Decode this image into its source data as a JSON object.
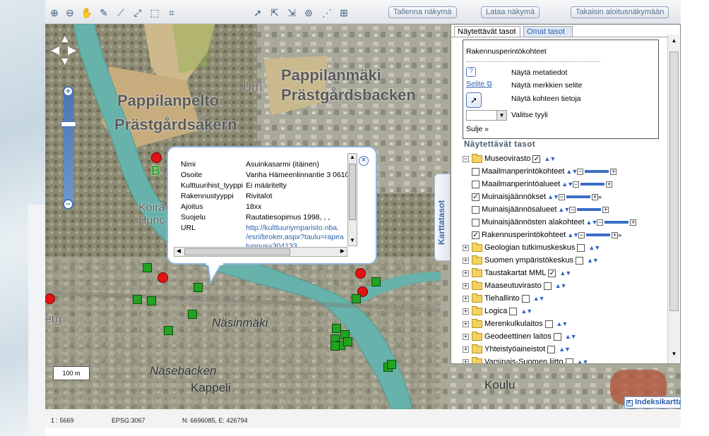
{
  "toolbar": {
    "save_view": "Tallenna näkymä",
    "load_view": "Lataa näkymä",
    "reset_view": "Takaisin aloitusnäkymään"
  },
  "map": {
    "labels": {
      "pappilanpelto": "Pappilanpelto",
      "prastgardsakern": "Prästgårdsåkern",
      "pappilanmaki": "Pappilanmäki",
      "prastgardsbacken": "Prästgårdsbacken",
      "urh": "Urh",
      "nasinmaki": "Näsinmäki",
      "nasebacken": "Näsebacken",
      "kappeli": "Kappeli",
      "koulu": "Koulu",
      "koira": "Koira",
      "hunc": "Hunc",
      "erg": "erg",
      "b": "B"
    },
    "scale_bar": "100 m",
    "index_map": "Indeksikartta",
    "map_layers_tab": "Karttatasot"
  },
  "popup": {
    "rows": [
      {
        "key": "Nimi",
        "value": "Asuinkasarmi (itäinen)"
      },
      {
        "key": "Osoite",
        "value": "Vanha Hämeenlinnantie 3 0610"
      },
      {
        "key": "Kulttuurihist_tyyppi",
        "value": "Ei määritelty"
      },
      {
        "key": "Rakennustyyppi",
        "value": "Rivitalot"
      },
      {
        "key": "Ajoitus",
        "value": "18xx"
      },
      {
        "key": "Suojelu",
        "value": "Rautatiesopimus 1998, , ,"
      },
      {
        "key": "URL",
        "value": "http://kulttuuriymparisto.nba."
      }
    ],
    "url_line2": "/esri/broker.aspx?taulu=rapea",
    "url_line3": "tunnus=304133"
  },
  "panel": {
    "tabs": [
      "Näytettävät tasot",
      "Omat tasot"
    ],
    "info": {
      "title": "Rakennusperintökohteet",
      "metadata": "Näytä metatiedot",
      "legend_link": "Selite",
      "legend": "Näytä merkkien selite",
      "show_info": "Näytä kohteen tietoja",
      "style": "Valitse tyyli",
      "close": "Sulje »"
    },
    "tree_title": "Näytettävät tasot",
    "tree": [
      {
        "label": "Museovirasto",
        "level": 0,
        "expanded": true,
        "checked": true
      },
      {
        "label": "Maailmanperintökohteet",
        "level": 1,
        "checked": false
      },
      {
        "label": "Maailmanperintöalueet",
        "level": 1,
        "checked": false
      },
      {
        "label": "Muinaisjäännökset",
        "level": 1,
        "checked": true
      },
      {
        "label": "Muinaisjäännösalueet",
        "level": 1,
        "checked": false
      },
      {
        "label": "Muinaisjäännösten alakohteet",
        "level": 1,
        "checked": false
      },
      {
        "label": "Rakennusperintökohteet",
        "level": 1,
        "checked": true
      },
      {
        "label": "Geologian tutkimuskeskus",
        "level": 0,
        "expanded": false,
        "checked": false
      },
      {
        "label": "Suomen ympäristökeskus",
        "level": 0,
        "expanded": false,
        "checked": false
      },
      {
        "label": "Taustakartat MML",
        "level": 0,
        "expanded": false,
        "checked": true
      },
      {
        "label": "Maaseutuvirasto",
        "level": 0,
        "expanded": false,
        "checked": false
      },
      {
        "label": "Tiehallinto",
        "level": 0,
        "expanded": false,
        "checked": false
      },
      {
        "label": "Logica",
        "level": 0,
        "expanded": false,
        "checked": false
      },
      {
        "label": "Merenkulkulaitos",
        "level": 0,
        "expanded": false,
        "checked": false
      },
      {
        "label": "Geodeettinen laitos",
        "level": 0,
        "expanded": false,
        "checked": false
      },
      {
        "label": "Yhteistyöaineistot",
        "level": 0,
        "expanded": false,
        "checked": false
      },
      {
        "label": "Varsinais-Suomen liitto",
        "level": 0,
        "expanded": false,
        "checked": false
      }
    ]
  },
  "status": {
    "scale": "1 : 5669",
    "epsg": "EPSG:3067",
    "coords": "N: 6696085, E: 426794"
  }
}
